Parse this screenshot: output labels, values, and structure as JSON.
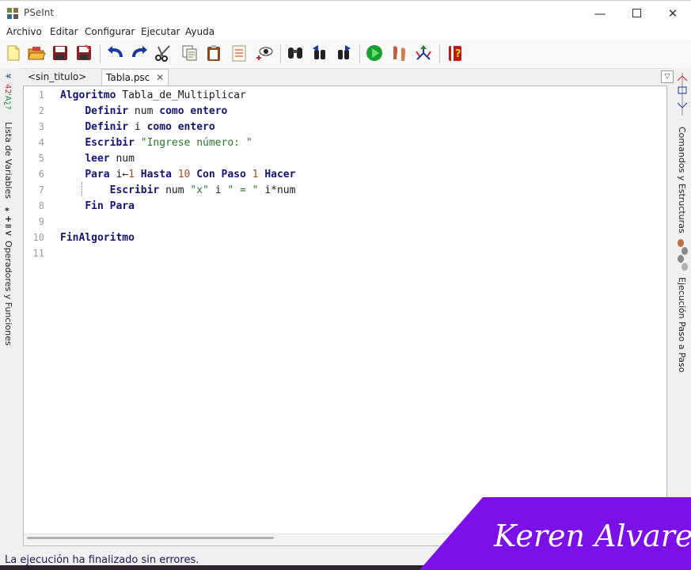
{
  "window": {
    "title": "PSeInt"
  },
  "menu": [
    "Archivo",
    "Editar",
    "Configurar",
    "Ejecutar",
    "Ayuda"
  ],
  "tabs": [
    {
      "label": "<sin_titulo>",
      "active": false
    },
    {
      "label": "Tabla.psc",
      "active": true,
      "close": "✕"
    }
  ],
  "left_panels": [
    "Lista de Variables",
    "Operadores y Funciones"
  ],
  "right_panels": [
    "Comandos y Estructuras",
    "Ejecución Paso a Paso"
  ],
  "editor": {
    "line_numbers": [
      "1",
      "2",
      "3",
      "4",
      "5",
      "6",
      "7",
      "8",
      "9",
      "10",
      "11"
    ],
    "lines": [
      [
        {
          "t": "Algoritmo",
          "c": "kw"
        },
        {
          "t": " Tabla_de_Multiplicar",
          "c": ""
        }
      ],
      [
        {
          "t": "    ",
          "c": ""
        },
        {
          "t": "Definir",
          "c": "kw"
        },
        {
          "t": " num ",
          "c": ""
        },
        {
          "t": "como",
          "c": "kw"
        },
        {
          "t": " ",
          "c": ""
        },
        {
          "t": "entero",
          "c": "kw"
        }
      ],
      [
        {
          "t": "    ",
          "c": ""
        },
        {
          "t": "Definir",
          "c": "kw"
        },
        {
          "t": " i ",
          "c": ""
        },
        {
          "t": "como",
          "c": "kw"
        },
        {
          "t": " ",
          "c": ""
        },
        {
          "t": "entero",
          "c": "kw"
        }
      ],
      [
        {
          "t": "    ",
          "c": ""
        },
        {
          "t": "Escribir",
          "c": "kw"
        },
        {
          "t": " ",
          "c": ""
        },
        {
          "t": "\"Ingrese número: \"",
          "c": "str"
        }
      ],
      [
        {
          "t": "    ",
          "c": ""
        },
        {
          "t": "leer",
          "c": "kw"
        },
        {
          "t": " num",
          "c": ""
        }
      ],
      [
        {
          "t": "    ",
          "c": ""
        },
        {
          "t": "Para",
          "c": "kw"
        },
        {
          "t": " i←",
          "c": ""
        },
        {
          "t": "1",
          "c": "num"
        },
        {
          "t": " ",
          "c": ""
        },
        {
          "t": "Hasta",
          "c": "kw"
        },
        {
          "t": " ",
          "c": ""
        },
        {
          "t": "10",
          "c": "num"
        },
        {
          "t": " ",
          "c": ""
        },
        {
          "t": "Con Paso",
          "c": "kw"
        },
        {
          "t": " ",
          "c": ""
        },
        {
          "t": "1",
          "c": "num"
        },
        {
          "t": " ",
          "c": ""
        },
        {
          "t": "Hacer",
          "c": "kw"
        }
      ],
      [
        {
          "t": "        ",
          "c": ""
        },
        {
          "t": "Escribir",
          "c": "kw"
        },
        {
          "t": " num ",
          "c": ""
        },
        {
          "t": "\"x\"",
          "c": "str"
        },
        {
          "t": " i ",
          "c": ""
        },
        {
          "t": "\" = \"",
          "c": "str"
        },
        {
          "t": " i*num",
          "c": ""
        }
      ],
      [
        {
          "t": "    ",
          "c": ""
        },
        {
          "t": "Fin Para",
          "c": "kw"
        }
      ],
      [],
      [
        {
          "t": "FinAlgoritmo",
          "c": "kw"
        }
      ],
      []
    ]
  },
  "status": "La ejecución ha finalizado sin errores.",
  "watermark": "Keren Alvarez",
  "colors": {
    "keyword": "#141474",
    "string": "#2a7a2a",
    "number": "#9a4e2a",
    "watermark_bg": "#7b10e8"
  }
}
